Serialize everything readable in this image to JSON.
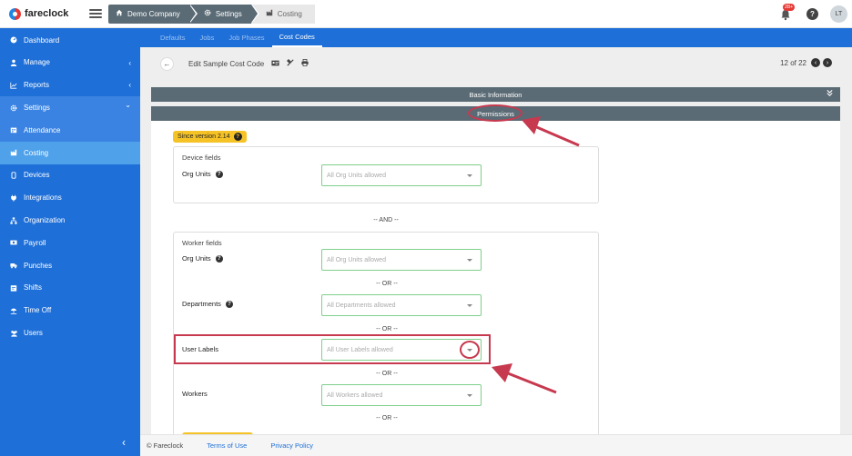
{
  "app": {
    "logo_text": "fareclock"
  },
  "breadcrumb": [
    {
      "label": "Demo Company",
      "icon": "home-icon"
    },
    {
      "label": "Settings",
      "icon": "gear-icon"
    },
    {
      "label": "Costing",
      "icon": "factory-icon"
    }
  ],
  "header": {
    "notification_count": "28+",
    "help": "?",
    "avatar_initials": "LT"
  },
  "sidebar": {
    "items": [
      {
        "label": "Dashboard",
        "icon": "dashboard-icon"
      },
      {
        "label": "Manage",
        "icon": "person-icon",
        "chevron": "‹"
      },
      {
        "label": "Reports",
        "icon": "chart-icon",
        "chevron": "‹"
      },
      {
        "label": "Settings",
        "icon": "gear-icon",
        "chevron": "⌄"
      },
      {
        "label": "Attendance",
        "icon": "attendance-icon"
      },
      {
        "label": "Costing",
        "icon": "factory-icon"
      },
      {
        "label": "Devices",
        "icon": "tablet-icon"
      },
      {
        "label": "Integrations",
        "icon": "plug-icon"
      },
      {
        "label": "Organization",
        "icon": "org-chart-icon"
      },
      {
        "label": "Payroll",
        "icon": "money-icon"
      },
      {
        "label": "Punches",
        "icon": "truck-icon"
      },
      {
        "label": "Shifts",
        "icon": "calendar-icon"
      },
      {
        "label": "Time Off",
        "icon": "beach-icon"
      },
      {
        "label": "Users",
        "icon": "users-icon"
      }
    ],
    "collapse_glyph": "‹"
  },
  "tabs": [
    "Defaults",
    "Jobs",
    "Job Phases",
    "Cost Codes"
  ],
  "toolbar": {
    "back_glyph": "←",
    "title": "Edit Sample Cost Code",
    "pager_text": "12 of 22",
    "prev_glyph": "‹",
    "next_glyph": "›"
  },
  "sections": {
    "basic_info": "Basic Information",
    "permissions": "Permissions",
    "collapse_glyph": "≫"
  },
  "permissions": {
    "version_badge": "Since version 2.14",
    "device_fields": {
      "title": "Device fields",
      "org_units": {
        "label": "Org Units",
        "placeholder": "All Org Units allowed"
      }
    },
    "and_separator": "-- AND --",
    "worker_fields": {
      "title": "Worker fields",
      "org_units": {
        "label": "Org Units",
        "placeholder": "All Org Units allowed"
      },
      "departments": {
        "label": "Departments",
        "placeholder": "All Departments allowed"
      },
      "user_labels": {
        "label": "User Labels",
        "placeholder": "All User Labels allowed"
      },
      "workers": {
        "label": "Workers",
        "placeholder": "All Workers allowed"
      },
      "or_separator": "-- OR --"
    }
  },
  "footer": {
    "copyright": "© Fareclock",
    "terms": "Terms of Use",
    "privacy": "Privacy Policy"
  },
  "colors": {
    "sidebar": "#1e6fd8",
    "section_bar": "#5b6b75",
    "badge": "#f6c326",
    "annotation": "#c7394f",
    "select_border": "#7fcf8a"
  }
}
